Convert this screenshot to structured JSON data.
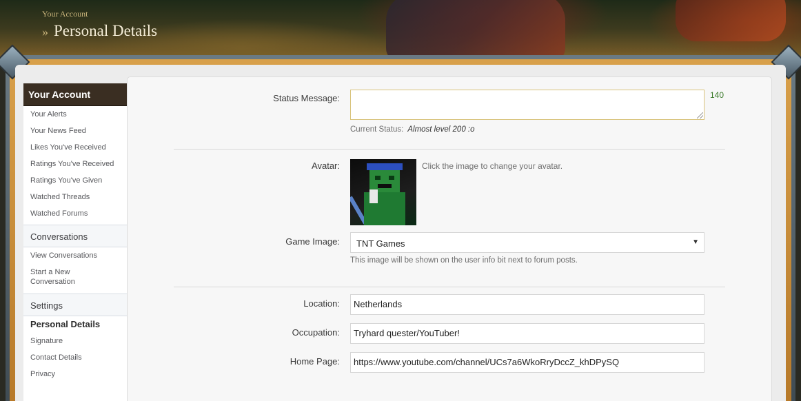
{
  "header": {
    "breadcrumb_parent": "Your Account",
    "breadcrumb_sep": "»",
    "page_title": "Personal Details"
  },
  "sidebar": {
    "account_heading": "Your Account",
    "account_items": [
      {
        "label": "Your Alerts"
      },
      {
        "label": "Your News Feed"
      },
      {
        "label": "Likes You've Received"
      },
      {
        "label": "Ratings You've Received"
      },
      {
        "label": "Ratings You've Given"
      },
      {
        "label": "Watched Threads"
      },
      {
        "label": "Watched Forums"
      }
    ],
    "conversations_heading": "Conversations",
    "conversation_items": [
      {
        "label": "View Conversations"
      },
      {
        "label": "Start a New Conversation"
      }
    ],
    "settings_heading": "Settings",
    "settings_items": [
      {
        "label": "Personal Details",
        "active": true
      },
      {
        "label": "Signature"
      },
      {
        "label": "Contact Details"
      },
      {
        "label": "Privacy"
      }
    ]
  },
  "form": {
    "status_label": "Status Message:",
    "status_value": "",
    "status_counter": "140",
    "current_status_label": "Current Status:",
    "current_status_value": "Almost level 200 :o",
    "avatar_label": "Avatar:",
    "avatar_hint": "Click the image to change your avatar.",
    "game_image_label": "Game Image:",
    "game_image_value": "TNT Games",
    "game_image_hint": "This image will be shown on the user info bit next to forum posts.",
    "location_label": "Location:",
    "location_value": "Netherlands",
    "occupation_label": "Occupation:",
    "occupation_value": "Tryhard quester/YouTuber!",
    "homepage_label": "Home Page:",
    "homepage_value": "https://www.youtube.com/channel/UCs7a6WkoRryDccZ_khDPySQ"
  },
  "colors": {
    "sidebar_heading_bg": "#3a2e22",
    "frame_gold": "#d8a04a",
    "counter_green": "#3a7a2a"
  },
  "icons": {
    "select_caret": "▼"
  }
}
